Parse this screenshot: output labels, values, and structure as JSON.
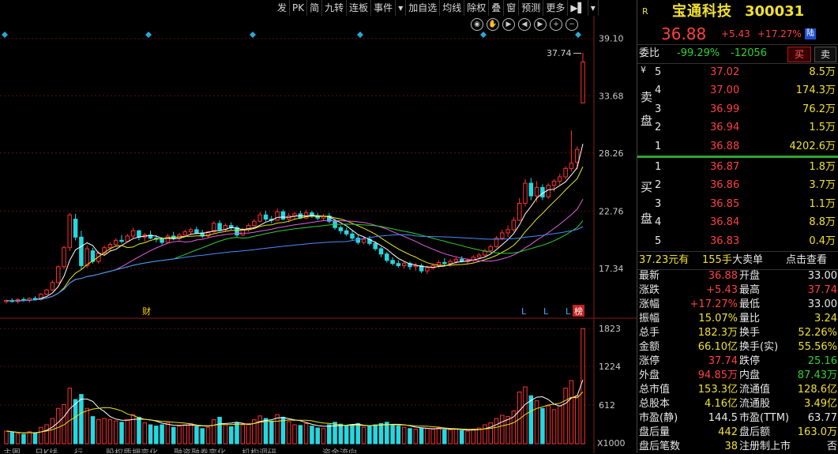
{
  "toolbar": {
    "items": [
      "发",
      "PK",
      "简",
      "九转",
      "连板",
      "事件",
      "▾",
      "加自选",
      "均线",
      "除权",
      "叠",
      "窗",
      "预测",
      "更多",
      "▶▌",
      "▾"
    ]
  },
  "price_axis": [
    "39.10",
    "33.68",
    "28.26",
    "22.76",
    "17.34"
  ],
  "volume_axis": [
    "1823",
    "1224",
    "612",
    "X1000"
  ],
  "high_marker": "37.74",
  "event_markers": {
    "cai": "财",
    "bang": "榜",
    "L": "L"
  },
  "chart_data": {
    "type": "candlestick",
    "price_ylim": [
      13.0,
      40.5
    ],
    "volume_ylim": [
      0,
      1900
    ],
    "candles": [
      [
        14.2,
        14.4,
        14.0,
        14.3,
        200
      ],
      [
        14.3,
        14.5,
        14.1,
        14.2,
        180
      ],
      [
        14.2,
        14.5,
        14.0,
        14.4,
        160
      ],
      [
        14.4,
        14.6,
        14.2,
        14.3,
        150
      ],
      [
        14.3,
        14.6,
        14.1,
        14.5,
        190
      ],
      [
        14.5,
        14.7,
        14.3,
        14.4,
        170
      ],
      [
        14.4,
        15.0,
        14.3,
        14.9,
        260
      ],
      [
        14.9,
        15.4,
        14.8,
        15.3,
        300
      ],
      [
        15.3,
        16.2,
        15.2,
        16.0,
        400
      ],
      [
        16.0,
        17.6,
        15.9,
        17.5,
        560
      ],
      [
        17.5,
        19.5,
        17.3,
        19.3,
        620
      ],
      [
        19.3,
        22.6,
        19.0,
        22.4,
        880
      ],
      [
        22.0,
        22.5,
        20.0,
        20.3,
        700
      ],
      [
        20.3,
        20.9,
        17.2,
        17.6,
        780
      ],
      [
        17.6,
        19.5,
        17.4,
        19.2,
        560
      ],
      [
        19.0,
        19.3,
        17.8,
        18.0,
        430
      ],
      [
        18.0,
        19.0,
        17.8,
        18.8,
        380
      ],
      [
        18.8,
        19.5,
        18.6,
        19.3,
        400
      ],
      [
        19.3,
        19.8,
        19.0,
        19.6,
        380
      ],
      [
        19.6,
        20.2,
        19.4,
        20.0,
        360
      ],
      [
        20.0,
        20.5,
        19.7,
        19.9,
        340
      ],
      [
        19.9,
        20.6,
        19.8,
        20.4,
        380
      ],
      [
        20.4,
        21.2,
        20.2,
        20.9,
        460
      ],
      [
        20.9,
        21.0,
        20.0,
        20.3,
        420
      ],
      [
        20.3,
        20.7,
        19.9,
        20.5,
        330
      ],
      [
        20.5,
        20.9,
        20.1,
        20.2,
        300
      ],
      [
        20.2,
        20.5,
        19.8,
        20.1,
        280
      ],
      [
        20.1,
        20.3,
        19.6,
        19.8,
        300
      ],
      [
        19.8,
        20.6,
        19.7,
        20.4,
        330
      ],
      [
        20.4,
        20.8,
        20.0,
        20.2,
        260
      ],
      [
        20.2,
        20.7,
        20.0,
        20.5,
        280
      ],
      [
        20.5,
        21.0,
        20.3,
        20.8,
        300
      ],
      [
        20.8,
        21.2,
        20.5,
        21.0,
        320
      ],
      [
        21.0,
        21.3,
        20.6,
        20.7,
        270
      ],
      [
        20.7,
        21.0,
        20.2,
        20.4,
        240
      ],
      [
        20.4,
        20.9,
        20.2,
        20.8,
        260
      ],
      [
        20.8,
        21.8,
        20.7,
        21.6,
        380
      ],
      [
        21.6,
        21.9,
        20.9,
        21.0,
        420
      ],
      [
        21.0,
        21.6,
        20.8,
        21.4,
        300
      ],
      [
        21.4,
        21.7,
        21.0,
        21.2,
        270
      ],
      [
        21.2,
        21.4,
        20.3,
        20.5,
        330
      ],
      [
        20.5,
        21.2,
        20.4,
        21.0,
        300
      ],
      [
        21.0,
        21.6,
        20.8,
        21.4,
        320
      ],
      [
        21.4,
        22.0,
        21.2,
        21.8,
        380
      ],
      [
        21.8,
        22.7,
        21.7,
        22.4,
        440
      ],
      [
        22.4,
        22.8,
        21.8,
        22.0,
        400
      ],
      [
        22.0,
        22.3,
        21.6,
        21.9,
        360
      ],
      [
        21.9,
        23.0,
        21.8,
        22.7,
        460
      ],
      [
        22.7,
        22.9,
        21.9,
        22.0,
        420
      ],
      [
        22.0,
        22.6,
        21.7,
        22.3,
        350
      ],
      [
        22.3,
        22.7,
        22.0,
        22.5,
        300
      ],
      [
        22.5,
        22.8,
        22.0,
        22.1,
        290
      ],
      [
        22.1,
        22.9,
        22.0,
        22.6,
        320
      ],
      [
        22.6,
        22.8,
        22.1,
        22.3,
        280
      ],
      [
        22.3,
        22.6,
        21.9,
        22.1,
        250
      ],
      [
        22.1,
        22.5,
        21.9,
        22.3,
        240
      ],
      [
        22.3,
        22.6,
        21.6,
        21.8,
        300
      ],
      [
        21.8,
        22.0,
        21.0,
        21.2,
        340
      ],
      [
        21.2,
        21.4,
        20.6,
        20.9,
        310
      ],
      [
        20.9,
        21.2,
        20.4,
        20.6,
        280
      ],
      [
        20.6,
        20.9,
        20.0,
        20.2,
        300
      ],
      [
        20.2,
        20.5,
        19.6,
        19.8,
        320
      ],
      [
        19.8,
        20.3,
        19.6,
        20.1,
        260
      ],
      [
        20.1,
        20.4,
        19.5,
        19.7,
        280
      ],
      [
        19.7,
        19.9,
        19.0,
        19.2,
        300
      ],
      [
        19.2,
        19.4,
        18.4,
        18.7,
        320
      ],
      [
        18.7,
        18.9,
        17.9,
        18.1,
        340
      ],
      [
        18.1,
        18.4,
        17.6,
        17.8,
        300
      ],
      [
        17.8,
        18.1,
        17.4,
        17.6,
        280
      ],
      [
        17.6,
        18.0,
        17.3,
        17.8,
        260
      ],
      [
        17.8,
        18.0,
        17.2,
        17.5,
        240
      ],
      [
        17.5,
        17.9,
        17.1,
        17.6,
        230
      ],
      [
        17.6,
        17.8,
        16.9,
        17.1,
        250
      ],
      [
        17.1,
        17.6,
        16.8,
        17.4,
        240
      ],
      [
        17.4,
        17.8,
        17.2,
        17.6,
        230
      ],
      [
        17.6,
        18.1,
        17.4,
        17.9,
        250
      ],
      [
        17.9,
        18.3,
        17.6,
        17.8,
        220
      ],
      [
        17.8,
        18.2,
        17.5,
        18.0,
        220
      ],
      [
        18.0,
        18.4,
        17.8,
        18.2,
        230
      ],
      [
        18.2,
        18.5,
        17.9,
        18.0,
        210
      ],
      [
        18.0,
        18.3,
        17.7,
        18.1,
        200
      ],
      [
        18.1,
        18.6,
        17.9,
        18.4,
        230
      ],
      [
        18.4,
        18.8,
        18.2,
        18.6,
        250
      ],
      [
        18.6,
        19.2,
        18.5,
        19.0,
        300
      ],
      [
        19.0,
        19.6,
        18.8,
        19.4,
        330
      ],
      [
        19.4,
        20.4,
        19.3,
        20.2,
        400
      ],
      [
        20.2,
        21.0,
        20.0,
        20.7,
        450
      ],
      [
        20.7,
        21.4,
        20.3,
        21.0,
        430
      ],
      [
        21.0,
        22.2,
        20.8,
        21.9,
        520
      ],
      [
        21.9,
        24.0,
        21.8,
        23.5,
        820
      ],
      [
        23.5,
        25.8,
        23.2,
        25.4,
        900
      ],
      [
        25.4,
        25.9,
        23.8,
        24.2,
        760
      ],
      [
        24.2,
        25.6,
        23.6,
        25.0,
        680
      ],
      [
        25.0,
        25.3,
        23.8,
        24.1,
        560
      ],
      [
        24.1,
        25.4,
        23.9,
        25.2,
        600
      ],
      [
        25.2,
        25.8,
        24.6,
        25.6,
        540
      ],
      [
        25.6,
        26.3,
        25.2,
        26.0,
        600
      ],
      [
        26.0,
        27.0,
        25.8,
        26.8,
        880
      ],
      [
        26.8,
        30.4,
        26.5,
        27.3,
        1000
      ],
      [
        27.4,
        28.9,
        26.7,
        28.6,
        760
      ],
      [
        33.0,
        37.74,
        33.0,
        36.88,
        1823
      ]
    ],
    "ma": {
      "colors": [
        "#ffffff",
        "#e8e820",
        "#e060e0",
        "#30d030",
        "#4a8cff"
      ],
      "periods": [
        5,
        10,
        20,
        30,
        60
      ]
    }
  },
  "stock": {
    "flag": "R",
    "name": "宝通科技",
    "code": "300031",
    "price": "36.88",
    "change": "+5.43",
    "pct": "+17.27%",
    "badge": "陆"
  },
  "weibi": {
    "label": "委比",
    "pct": "-99.29%",
    "diff": "-12056",
    "buy_btn": "买",
    "sell_btn": "卖"
  },
  "sell_label": [
    "¥",
    "卖",
    "盘"
  ],
  "buy_label": [
    "买",
    "盘"
  ],
  "sell": [
    {
      "lvl": "5",
      "price": "37.02",
      "vol": "8.5万"
    },
    {
      "lvl": "4",
      "price": "37.00",
      "vol": "174.3万"
    },
    {
      "lvl": "3",
      "price": "36.99",
      "vol": "76.2万"
    },
    {
      "lvl": "2",
      "price": "36.94",
      "vol": "1.5万"
    },
    {
      "lvl": "1",
      "price": "36.88",
      "vol": "4202.6万"
    }
  ],
  "buy": [
    {
      "lvl": "1",
      "price": "36.87",
      "vol": "1.8万"
    },
    {
      "lvl": "2",
      "price": "36.86",
      "vol": "3.7万"
    },
    {
      "lvl": "3",
      "price": "36.85",
      "vol": "1.1万"
    },
    {
      "lvl": "4",
      "price": "36.84",
      "vol": "8.8万"
    },
    {
      "lvl": "5",
      "price": "36.83",
      "vol": "0.4万"
    }
  ],
  "bigorder": {
    "amount": "37.23元有",
    "hands": "155手",
    "label": "大卖单",
    "link": "点击查看"
  },
  "quote": [
    [
      "最新",
      "36.88",
      "red",
      "开盘",
      "33.00",
      "white"
    ],
    [
      "涨跌",
      "+5.43",
      "red",
      "最高",
      "37.74",
      "red"
    ],
    [
      "涨幅",
      "+17.27%",
      "red",
      "最低",
      "33.00",
      "white"
    ],
    [
      "振幅",
      "15.07%",
      "yellow",
      "量比",
      "3.24",
      "yellow"
    ],
    [
      "总手",
      "182.3万",
      "yellow",
      "换手",
      "52.26%",
      "yellow"
    ],
    [
      "金额",
      "66.10亿",
      "yellow",
      "换手(实)",
      "55.56%",
      "yellow"
    ],
    [
      "涨停",
      "37.74",
      "red",
      "跌停",
      "25.16",
      "green"
    ],
    [
      "外盘",
      "94.85万",
      "red",
      "内盘",
      "87.43万",
      "green"
    ],
    [
      "总市值",
      "153.3亿",
      "yellow",
      "流通值",
      "128.6亿",
      "yellow"
    ],
    [
      "总股本",
      "4.16亿",
      "yellow",
      "流通股",
      "3.49亿",
      "yellow"
    ],
    [
      "市盈(静)",
      "144.5",
      "white",
      "市盈(TTM)",
      "63.77",
      "white"
    ],
    [
      "盘后量",
      "442",
      "yellow",
      "盘后额",
      "163.0万",
      "yellow"
    ],
    [
      "盘后笔数",
      "38",
      "yellow",
      "注册制上市",
      "否",
      "white"
    ]
  ],
  "bottom_tabs": [
    "主图",
    "日K线",
    "行",
    "股权质押变化",
    "融资融券变化",
    "机构调研",
    "",
    "资金流向"
  ]
}
